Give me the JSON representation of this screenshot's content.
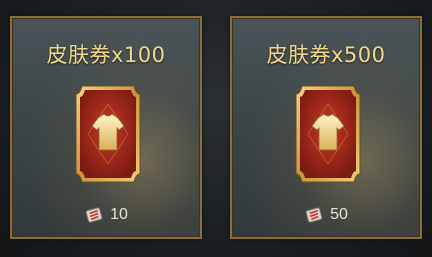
{
  "cards": [
    {
      "title": "皮肤券x100",
      "price": "10",
      "icon": "skin-ticket-icon",
      "currency_icon": "gem-icon"
    },
    {
      "title": "皮肤券x500",
      "price": "50",
      "icon": "skin-ticket-icon",
      "currency_icon": "gem-icon"
    }
  ],
  "colors": {
    "title": "#f2d889",
    "border": "#8a6f3c",
    "ticket_red": "#a8271b",
    "ticket_gold": "#e0b45a"
  }
}
